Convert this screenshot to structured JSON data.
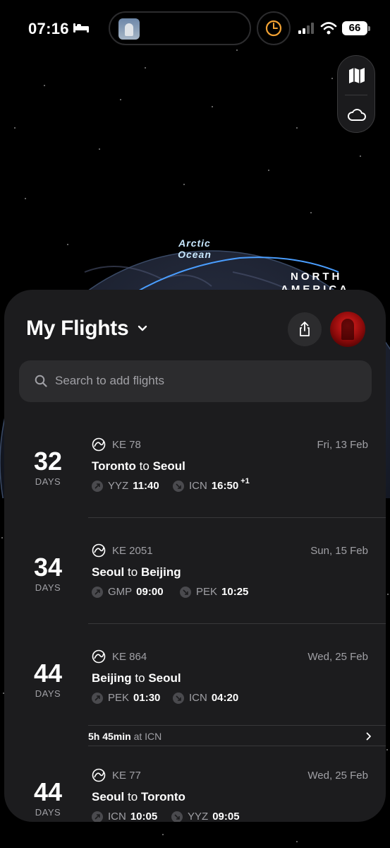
{
  "status_bar": {
    "time": "07:16",
    "battery": "66"
  },
  "map": {
    "ocean_label_line1": "Arctic",
    "ocean_label_line2": "Ocean",
    "continent_line1": "NORTH",
    "continent_line2": "AMERICA"
  },
  "sheet": {
    "title": "My Flights",
    "search_placeholder": "Search to add flights"
  },
  "flights": [
    {
      "days": "32",
      "days_label": "DAYS",
      "flight_no": "KE 78",
      "date": "Fri, 13 Feb",
      "from_city": "Toronto",
      "to_word": "to",
      "to_city": "Seoul",
      "dep_code": "YYZ",
      "dep_time": "11:40",
      "arr_code": "ICN",
      "arr_time": "16:50",
      "arr_offset": "+1"
    },
    {
      "days": "34",
      "days_label": "DAYS",
      "flight_no": "KE 2051",
      "date": "Sun, 15 Feb",
      "from_city": "Seoul",
      "to_word": "to",
      "to_city": "Beijing",
      "dep_code": "GMP",
      "dep_time": "09:00",
      "arr_code": "PEK",
      "arr_time": "10:25"
    },
    {
      "days": "44",
      "days_label": "DAYS",
      "flight_no": "KE 864",
      "date": "Wed, 25 Feb",
      "from_city": "Beijing",
      "to_word": "to",
      "to_city": "Seoul",
      "dep_code": "PEK",
      "dep_time": "01:30",
      "arr_code": "ICN",
      "arr_time": "04:20"
    },
    {
      "days": "44",
      "days_label": "DAYS",
      "flight_no": "KE 77",
      "date": "Wed, 25 Feb",
      "from_city": "Seoul",
      "to_word": "to",
      "to_city": "Toronto",
      "dep_code": "ICN",
      "dep_time": "10:05",
      "arr_code": "YYZ",
      "arr_time": "09:05"
    }
  ],
  "layover": {
    "duration": "5h 45min",
    "at": "at ICN"
  },
  "colors": {
    "background": "#000000",
    "sheet": "#1c1c1e",
    "field": "#2c2c2e",
    "secondary_text": "#a0a0a5",
    "route_line": "#4a9eff"
  }
}
